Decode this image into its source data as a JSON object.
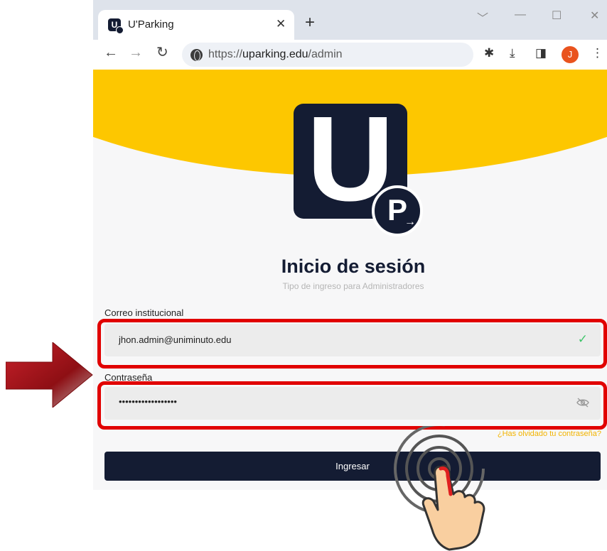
{
  "browser": {
    "tab_title": "U'Parking",
    "tab_favicon_letter": "U",
    "url_prefix": "https://",
    "url_domain": "uparking.edu",
    "url_path": "/admin",
    "profile_initial": "J"
  },
  "logo": {
    "main_letter": "U",
    "badge_letter": "P"
  },
  "login": {
    "title": "Inicio de sesión",
    "subtitle": "Tipo de ingreso para Administradores",
    "email_label": "Correo institucional",
    "email_value": "jhon.admin@uniminuto.edu",
    "password_label": "Contraseña",
    "password_value": "••••••••••••••••••",
    "forgot_link": "¿Has olvidado tu contraseña?",
    "submit_label": "Ingresar"
  },
  "icons": {
    "tab_close": "close-icon",
    "new_tab": "plus-icon",
    "back": "arrow-left-icon",
    "forward": "arrow-right-icon",
    "reload": "reload-icon",
    "site_info": "globe-icon",
    "extensions": "puzzle-icon",
    "downloads": "download-icon",
    "side_panel": "side-panel-icon",
    "menu": "kebab-menu-icon",
    "email_valid": "checkmark-icon",
    "password_visibility": "eye-off-icon"
  },
  "colors": {
    "brand_navy": "#141c33",
    "brand_yellow": "#fdc700",
    "annotation_red": "#e10000",
    "valid_green": "#3fc56a"
  }
}
